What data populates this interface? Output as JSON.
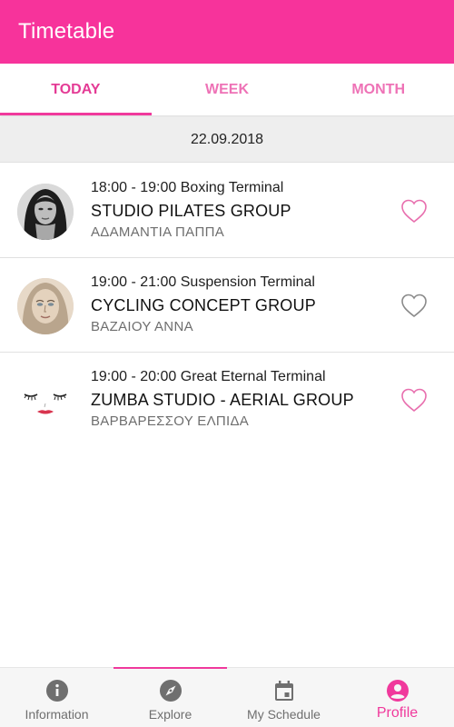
{
  "appbar": {
    "title": "Timetable",
    "color": "#f7339b"
  },
  "tabs": [
    {
      "label": "TODAY",
      "active": true
    },
    {
      "label": "WEEK",
      "active": false
    },
    {
      "label": "MONTH",
      "active": false
    }
  ],
  "date": "22.09.2018",
  "classes": [
    {
      "time": "18:00 - 19:00 Boxing Terminal",
      "name": "STUDIO PILATES GROUP",
      "teacher": "ΑΔΑΜΑΝΤΙΑ ΠΑΠΠΑ",
      "favorite": false,
      "avatar_icon": "woman-portrait-dark"
    },
    {
      "time": "19:00 - 21:00 Suspension Terminal",
      "name": "CYCLING CONCEPT GROUP",
      "teacher": "ΒΑΖΑΙΟΥ ΑΝΝΑ",
      "favorite": false,
      "avatar_icon": "woman-portrait-sketch"
    },
    {
      "time": "19:00 - 20:00 Great Eternal Terminal",
      "name": "ZUMBA STUDIO - AERIAL GROUP",
      "teacher": "ΒΑΡΒΑΡΕΣΣΟΥ ΕΛΠΙΔΑ",
      "favorite": false,
      "avatar_icon": "face-lashes-lips"
    }
  ],
  "bottom_nav": [
    {
      "label": "Information",
      "icon": "info-icon",
      "active": false
    },
    {
      "label": "Explore",
      "icon": "compass-icon",
      "active": false
    },
    {
      "label": "My Schedule",
      "icon": "calendar-icon",
      "active": false
    },
    {
      "label": "Profile",
      "icon": "account-icon",
      "active": true
    }
  ],
  "colors": {
    "accent": "#f0399c",
    "heart": "#e86fae",
    "nav_inactive": "#6f6f6f"
  }
}
